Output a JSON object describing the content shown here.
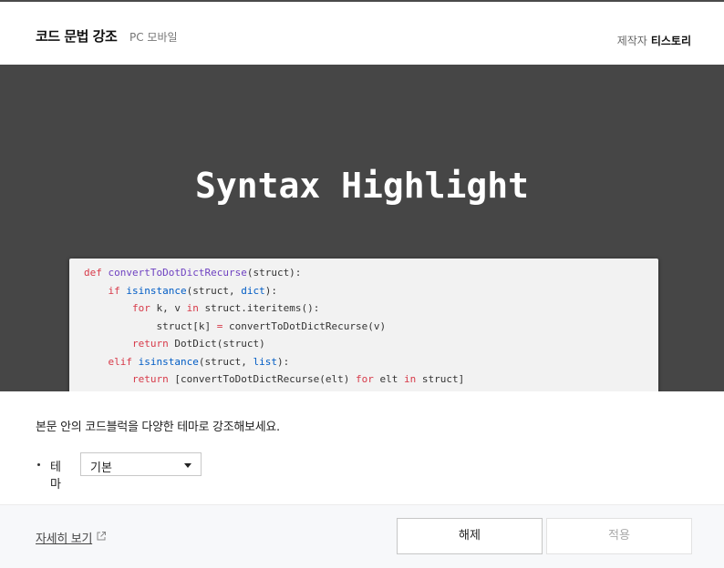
{
  "header": {
    "title": "코드 문법 강조",
    "platform": "PC 모바일",
    "maker_label": "제작자",
    "maker_name": "티스토리"
  },
  "preview": {
    "hero_title": "Syntax Highlight",
    "code_lines": [
      "def convertToDotDictRecurse(struct):",
      "    if isinstance(struct, dict):",
      "        for k, v in struct.iteritems():",
      "            struct[k] = convertToDotDictRecurse(v)",
      "        return DotDict(struct)",
      "    elif isinstance(struct, list):",
      "        return [convertToDotDictRecurse(elt) for elt in struct]"
    ]
  },
  "settings": {
    "description": "본문 안의 코드블럭을 다양한 테마로 강조해보세요.",
    "theme_label": "테마",
    "theme_value": "기본"
  },
  "footer": {
    "more_link": "자세히 보기",
    "release_button": "해제",
    "apply_button": "적용"
  },
  "colors": {
    "preview_bg": "#464646",
    "code_bg": "#f2f2f2",
    "keyword": "#d73a49",
    "function": "#6f42c1",
    "builtin": "#005cc5"
  },
  "icons": {
    "external_link": "external-link-icon",
    "dropdown_arrow": "caret-down-icon"
  }
}
